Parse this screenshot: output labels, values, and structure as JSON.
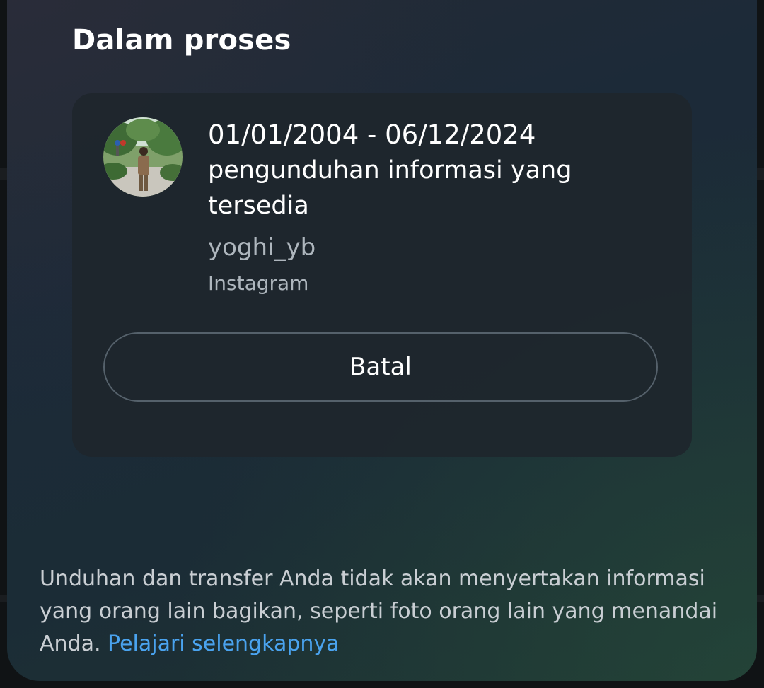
{
  "section": {
    "title": "Dalam proses"
  },
  "request": {
    "date_range": "01/01/2004 - 06/12/2024",
    "title": "pengunduhan informasi yang tersedia",
    "username": "yoghi_yb",
    "platform": "Instagram",
    "avatar_icon": "profile-photo"
  },
  "actions": {
    "cancel_label": "Batal"
  },
  "footer": {
    "note": "Unduhan dan transfer Anda tidak akan menyertakan informasi yang orang lain bagikan, seperti foto orang lain yang menandai Anda.",
    "link_label": "Pelajari selengkapnya"
  },
  "colors": {
    "link": "#4aa3ef",
    "text_primary": "#ffffff",
    "text_secondary": "#aeb6bd"
  }
}
